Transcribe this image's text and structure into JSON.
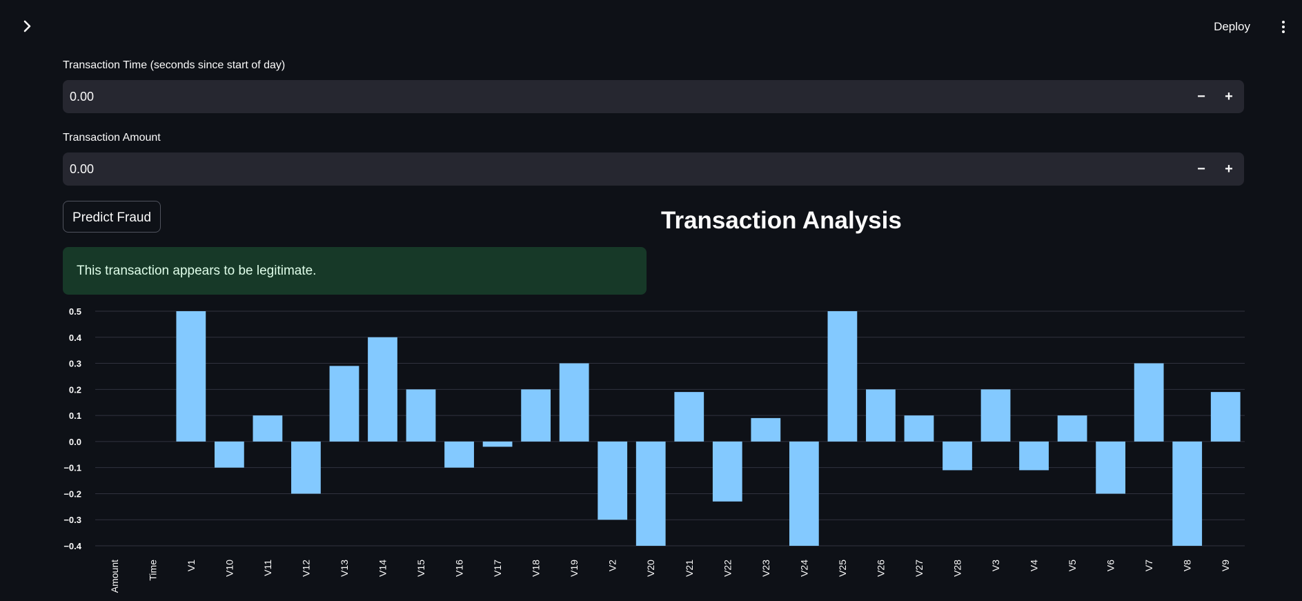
{
  "header": {
    "deploy_label": "Deploy",
    "menu_icon": "kebab-menu-icon",
    "sidebar_icon": "chevron-right-icon"
  },
  "inputs": {
    "time": {
      "label": "Transaction Time (seconds since start of day)",
      "value": "0.00",
      "minus": "−",
      "plus": "+"
    },
    "amount": {
      "label": "Transaction Amount",
      "value": "0.00",
      "minus": "−",
      "plus": "+"
    }
  },
  "predict_button": {
    "label": "Predict Fraud"
  },
  "result": {
    "message": "This transaction appears to be legitimate."
  },
  "section": {
    "title": "Transaction Analysis"
  },
  "colors": {
    "bar": "#83c9ff",
    "background": "#0e1117",
    "input_bg": "#262730",
    "success_bg": "#173928"
  },
  "chart_data": {
    "type": "bar",
    "categories": [
      "Amount",
      "Time",
      "V1",
      "V10",
      "V11",
      "V12",
      "V13",
      "V14",
      "V15",
      "V16",
      "V17",
      "V18",
      "V19",
      "V2",
      "V20",
      "V21",
      "V22",
      "V23",
      "V24",
      "V25",
      "V26",
      "V27",
      "V28",
      "V3",
      "V4",
      "V5",
      "V6",
      "V7",
      "V8",
      "V9"
    ],
    "values": [
      0,
      0,
      0.5,
      -0.1,
      0.1,
      -0.2,
      0.29,
      0.4,
      0.2,
      -0.1,
      -0.02,
      0.2,
      0.3,
      -0.3,
      -0.4,
      0.19,
      -0.23,
      0.09,
      -0.4,
      0.5,
      0.2,
      0.1,
      -0.11,
      0.2,
      -0.11,
      0.1,
      -0.2,
      0.3,
      -0.4,
      0.19
    ],
    "yticks": [
      "0.5",
      "0.4",
      "0.3",
      "0.2",
      "0.1",
      "0.0",
      "−0.1",
      "−0.2",
      "−0.3",
      "−0.4"
    ],
    "ylim": [
      -0.4,
      0.5
    ],
    "grid": true,
    "title": "",
    "xlabel": "",
    "ylabel": ""
  }
}
